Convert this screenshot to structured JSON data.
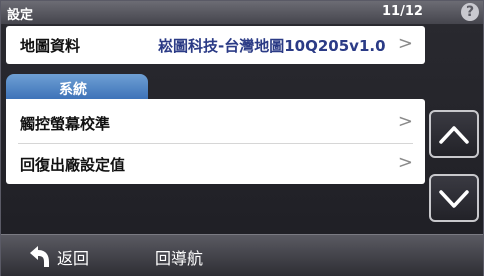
{
  "titlebar": {
    "title": "設定",
    "page_count": "11/12",
    "help": "?"
  },
  "map_data": {
    "label": "地圖資料",
    "value": "崧圖科技-台灣地圖10Q205v1.0",
    "chevron": ">"
  },
  "section": {
    "tab_label": "系統",
    "items": [
      {
        "label": "觸控螢幕校準",
        "chevron": ">"
      },
      {
        "label": "回復出廠設定值",
        "chevron": ">"
      }
    ]
  },
  "scroll": {
    "up_icon": "chevron-up-icon",
    "down_icon": "chevron-down-icon"
  },
  "bottombar": {
    "back_label": "返回",
    "nav_label": "回導航"
  },
  "colors": {
    "tab_blue": "#3a6fb6",
    "map_value": "#2b3b86"
  }
}
